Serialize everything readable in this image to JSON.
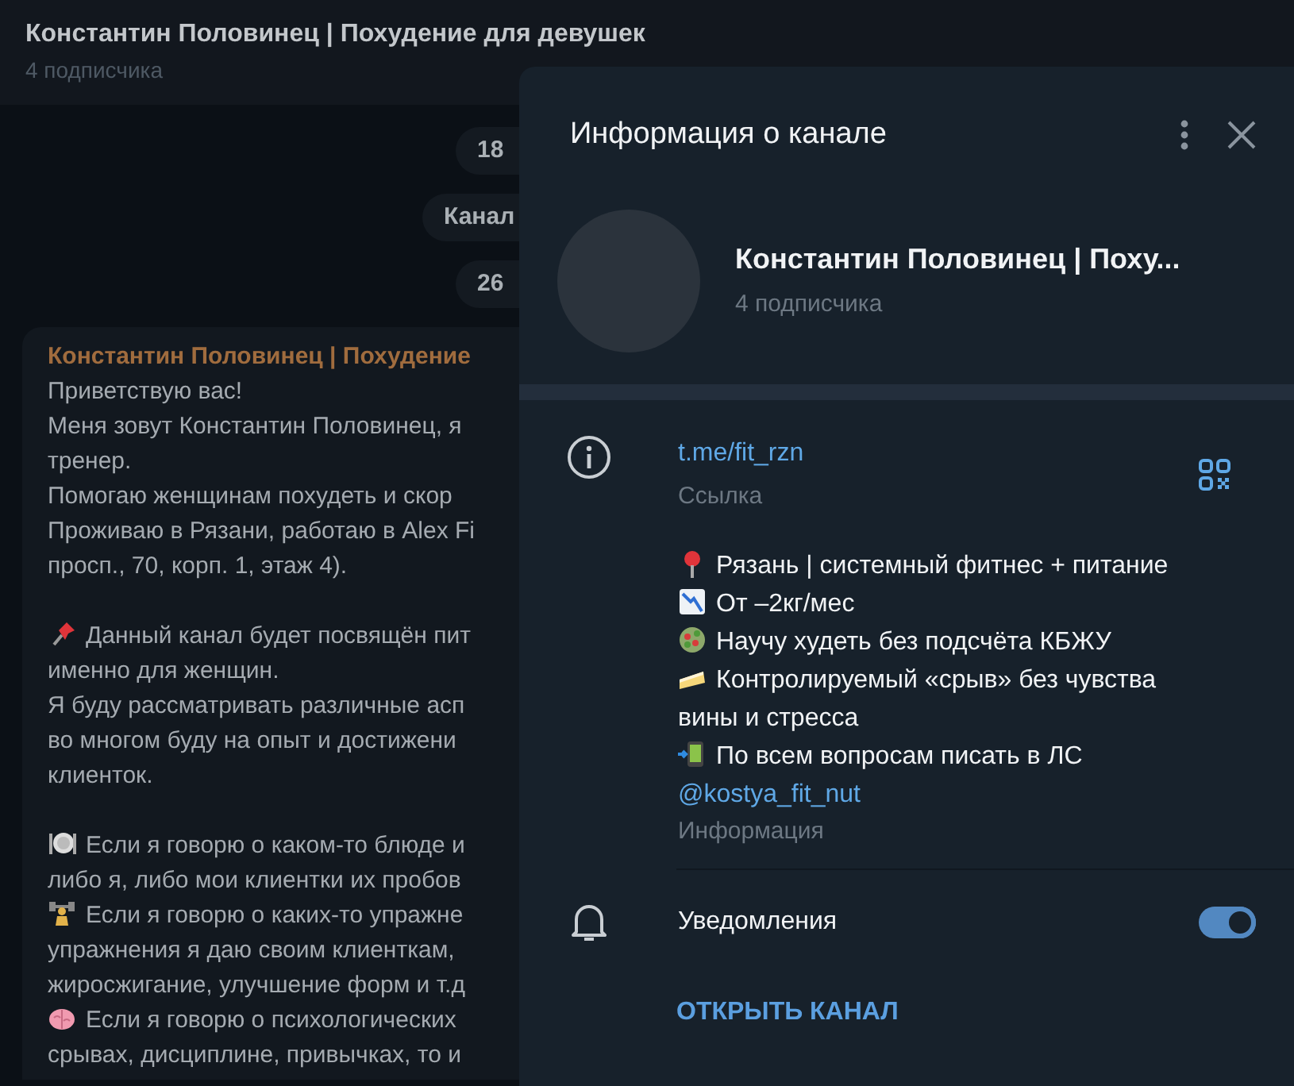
{
  "header": {
    "title": "Константин Половинец | Похудение для девушек",
    "subtitle": "4 подписчика"
  },
  "chat": {
    "date_pills": [
      {
        "text": "18"
      },
      {
        "text": "Канал"
      },
      {
        "text": "26"
      }
    ],
    "message": {
      "author": "Константин Половинец | Похудение",
      "lines": [
        {
          "kind": "text",
          "text": "Приветствую вас!"
        },
        {
          "kind": "text",
          "text": "Меня зовут Константин Половинец, я"
        },
        {
          "kind": "text",
          "text": "тренер."
        },
        {
          "kind": "text",
          "text": "Помогаю женщинам похудеть и скор"
        },
        {
          "kind": "text",
          "text": "Проживаю в Рязани, работаю в Alex Fi"
        },
        {
          "kind": "text",
          "text": "просп., 70, корп. 1, этаж 4)."
        },
        {
          "kind": "gap"
        },
        {
          "kind": "pin",
          "text": "Данный канал будет посвящён пит"
        },
        {
          "kind": "text",
          "text": "именно для женщин."
        },
        {
          "kind": "text",
          "text": "Я буду рассматривать различные асп"
        },
        {
          "kind": "text",
          "text": "во многом буду на опыт и достижени"
        },
        {
          "kind": "text",
          "text": "клиенток."
        },
        {
          "kind": "gap"
        },
        {
          "kind": "plate",
          "text": "Если я говорю о каком-то блюде и"
        },
        {
          "kind": "text",
          "text": "либо я, либо мои клиентки их пробов"
        },
        {
          "kind": "weights",
          "text": "Если я говорю о каких-то упражне"
        },
        {
          "kind": "text",
          "text": "упражнения я даю своим клиенткам,"
        },
        {
          "kind": "text",
          "text": "жиросжигание, улучшение форм и т.д"
        },
        {
          "kind": "brain",
          "text": "Если я говорю о психологических"
        },
        {
          "kind": "text",
          "text": "срывах, дисциплине, привычках, то и"
        }
      ]
    }
  },
  "info_panel": {
    "title": "Информация о канале",
    "name": "Константин Половинец | Поху...",
    "subscribers": "4 подписчика",
    "link": {
      "value": "t.me/fit_rzn",
      "label": "Ссылка"
    },
    "description": {
      "lines": [
        {
          "kind": "round-pin",
          "text": "Рязань | системный фитнес + питание"
        },
        {
          "kind": "chart",
          "text": "От –2кг/мес"
        },
        {
          "kind": "salad",
          "text": "Научу худеть без подсчёта КБЖУ"
        },
        {
          "kind": "cake",
          "text": "Контролируемый «срыв» без чувства"
        },
        {
          "kind": "text",
          "text": "вины и стресса"
        },
        {
          "kind": "phone",
          "text": "По всем вопросам писать в ЛС"
        }
      ],
      "mention": "@kostya_fit_nut",
      "label": "Информация"
    },
    "notifications": {
      "label": "Уведомления",
      "on": true
    },
    "action": "ОТКРЫТЬ КАНАЛ"
  }
}
